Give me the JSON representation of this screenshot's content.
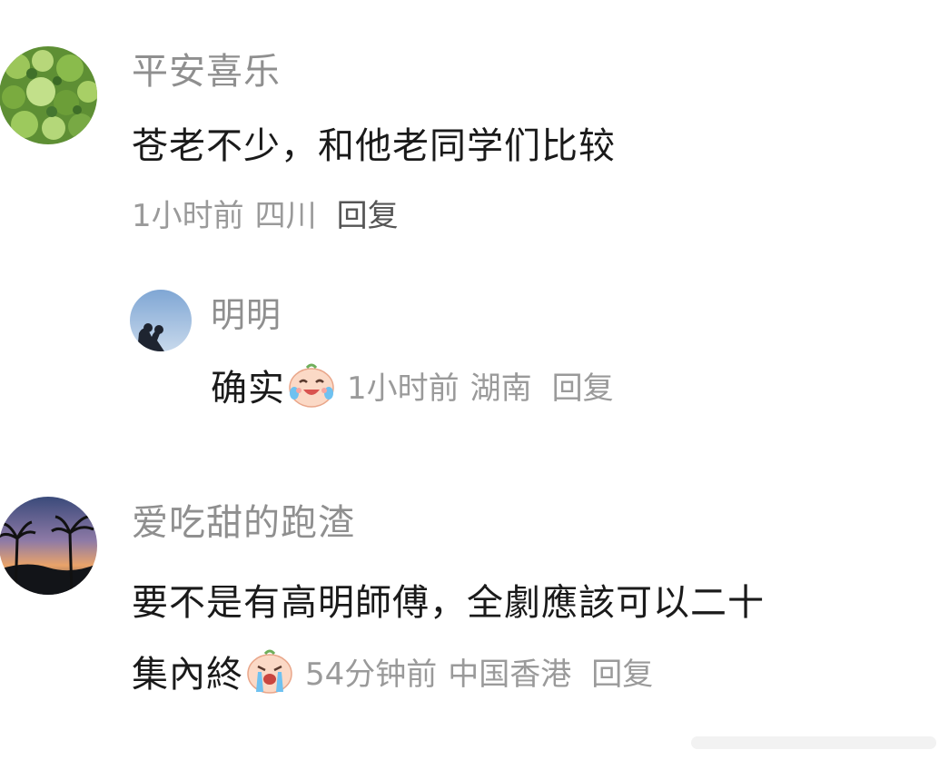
{
  "comments": [
    {
      "user": "平安喜乐",
      "text": "苍老不少，和他老同学们比较",
      "time": "1小时前",
      "location": "四川",
      "reply_label": "回复",
      "replies": [
        {
          "user": "明明",
          "text": "确实",
          "emoji": "laugh-cry-emoji",
          "time": "1小时前",
          "location": "湖南",
          "reply_label": "回复"
        }
      ]
    },
    {
      "user": "爱吃甜的跑渣",
      "text_line1": "要不是有高明師傅，全劇應該可以二十",
      "text_line2": "集內終",
      "emoji": "crying-emoji",
      "time": "54分钟前",
      "location": "中国香港",
      "reply_label": "回复"
    }
  ],
  "colors": {
    "username": "#8f8f8f",
    "content": "#1a1a1a",
    "meta": "#9a9a9a",
    "reply": "#555555"
  }
}
